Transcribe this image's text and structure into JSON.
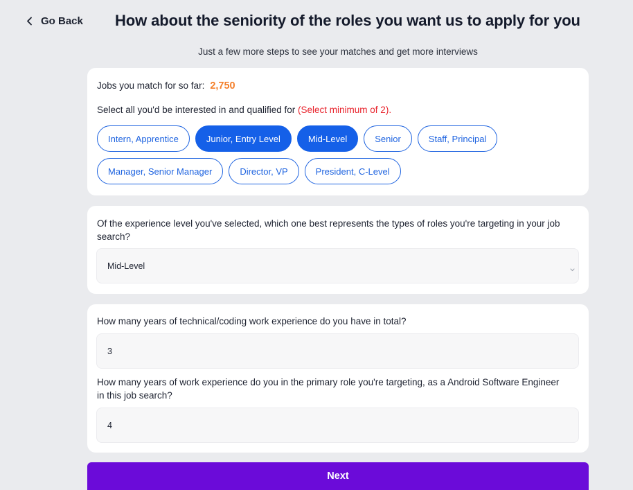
{
  "header": {
    "back_label": "Go Back",
    "title": "How about the seniority of the roles you want us to apply for you",
    "subtitle": "Just a few more steps to see your matches and get more interviews"
  },
  "seniority": {
    "match_label": "Jobs you match for so far:",
    "match_count": "2,750",
    "prompt": "Select all you'd be interested in and qualified for",
    "prompt_requirement": "(Select minimum of 2).",
    "options": [
      {
        "label": "Intern, Apprentice",
        "selected": false
      },
      {
        "label": "Junior, Entry Level",
        "selected": true
      },
      {
        "label": "Mid-Level",
        "selected": true
      },
      {
        "label": "Senior",
        "selected": false
      },
      {
        "label": "Staff, Principal",
        "selected": false
      },
      {
        "label": "Manager, Senior Manager",
        "selected": false
      },
      {
        "label": "Director, VP",
        "selected": false
      },
      {
        "label": "President, C-Level",
        "selected": false
      }
    ]
  },
  "target_level": {
    "question": "Of the experience level you've selected, which one best represents the types of roles you're targeting in your job search?",
    "selected_value": "Mid-Level"
  },
  "experience": {
    "total_question": "How many years of technical/coding work experience do you have in total?",
    "total_value": "3",
    "primary_question": "How many years of work experience do you in the primary role you're targeting, as a Android Software Engineer in this job search?",
    "primary_value": "4"
  },
  "footer": {
    "next_label": "Next"
  },
  "colors": {
    "accent_blue": "#1560e8",
    "match_orange": "#f47f2a",
    "required_red": "#e8232c",
    "next_purple": "#6b0bd9"
  },
  "icons": {
    "back": "chevron-left-icon",
    "select": "chevron-down-icon"
  }
}
